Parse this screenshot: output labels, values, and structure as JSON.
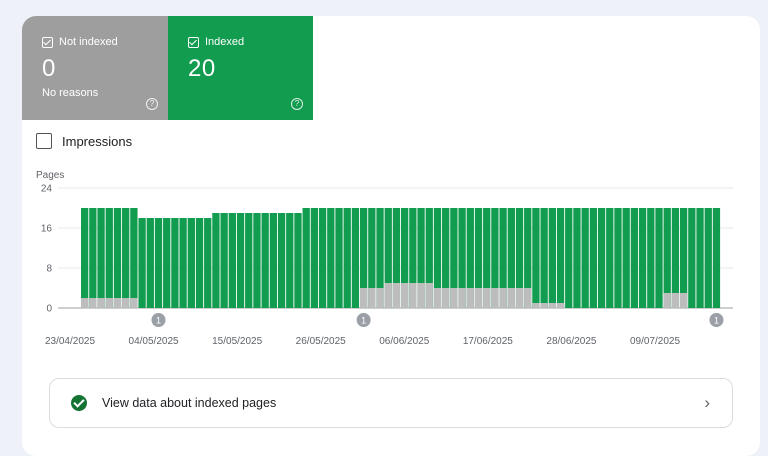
{
  "tiles": {
    "not_indexed": {
      "label": "Not indexed",
      "value": "0",
      "subtext": "No reasons",
      "help": "?"
    },
    "indexed": {
      "label": "Indexed",
      "value": "20",
      "help": "?"
    }
  },
  "impressions": {
    "label": "Impressions",
    "checked": false
  },
  "colors": {
    "indexed": "#129c4f",
    "not_indexed": "#bdbdbd",
    "tile_gray": "#9e9e9e"
  },
  "chart_data": {
    "type": "bar",
    "stacked": true,
    "ylabel": "Pages",
    "ylim": [
      0,
      24
    ],
    "yticks": [
      0,
      8,
      16,
      24
    ],
    "xtick_labels": [
      "23/04/2025",
      "04/05/2025",
      "15/05/2025",
      "26/05/2025",
      "06/06/2025",
      "17/06/2025",
      "28/06/2025",
      "09/07/2025"
    ],
    "series": [
      {
        "values": [
          20,
          20,
          20,
          20,
          20,
          20,
          20,
          18,
          18,
          18,
          18,
          18,
          18,
          18,
          18,
          18,
          19,
          19,
          19,
          19,
          19,
          19,
          19,
          19,
          19,
          19,
          19,
          20,
          20,
          20,
          20,
          20,
          20,
          20,
          20,
          20,
          20,
          20,
          20,
          20,
          20,
          20,
          20,
          20,
          20,
          20,
          20,
          20,
          20,
          20,
          20,
          20,
          20,
          20,
          20,
          20,
          20,
          20,
          20,
          20,
          20,
          20,
          20,
          20,
          20,
          20,
          20,
          20,
          20,
          20,
          20,
          20,
          20,
          20,
          20,
          20,
          20,
          20
        ]
      },
      {
        "values": [
          2,
          2,
          2,
          2,
          2,
          2,
          2,
          0,
          0,
          0,
          0,
          0,
          0,
          0,
          0,
          0,
          0,
          0,
          0,
          0,
          0,
          0,
          0,
          0,
          0,
          0,
          0,
          0,
          0,
          0,
          0,
          0,
          0,
          0,
          4,
          4,
          4,
          5,
          5,
          5,
          5,
          5,
          5,
          4,
          4,
          4,
          4,
          4,
          4,
          4,
          4,
          4,
          4,
          4,
          4,
          1,
          1,
          1,
          1,
          0,
          0,
          0,
          0,
          0,
          0,
          0,
          0,
          0,
          0,
          0,
          0,
          3,
          3,
          3,
          0,
          0,
          0,
          0
        ]
      }
    ],
    "annotations": [
      {
        "index": 9,
        "label": "1"
      },
      {
        "index": 34,
        "label": "1"
      },
      {
        "index": 77,
        "label": "1"
      }
    ]
  },
  "cta": {
    "label": "View data about indexed pages",
    "chevron": "›"
  }
}
